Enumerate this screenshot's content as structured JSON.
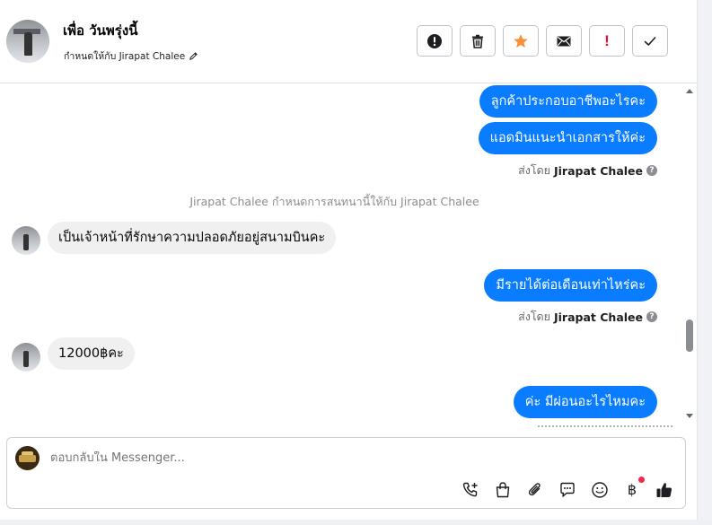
{
  "header": {
    "contact_name": "เพื่อ วันพรุ่งนี้",
    "assigned_label": "กำหนดให้กับ Jirapat Chalee",
    "toolbar": [
      {
        "name": "spam-alert-button",
        "icon": "exclamation-circle-icon"
      },
      {
        "name": "delete-button",
        "icon": "trash-icon"
      },
      {
        "name": "star-button",
        "icon": "star-icon",
        "color": "#f7923b"
      },
      {
        "name": "mark-unread-button",
        "icon": "envelope-icon"
      },
      {
        "name": "follow-up-button",
        "icon": "exclamation-icon",
        "text": "!",
        "color": "#e4162b"
      },
      {
        "name": "mark-done-button",
        "icon": "check-icon"
      }
    ]
  },
  "messages": {
    "out_1": "ลูกค้าประกอบอาชีพอะไรคะ",
    "out_2": "แอดมินแนะนำเอกสารให้ค่ะ",
    "sent_by_1": {
      "prefix": "ส่งโดย",
      "name": "Jirapat Chalee"
    },
    "system_note": "Jirapat Chalee กำหนดการสนทนานี้ให้กับ Jirapat Chalee",
    "in_1": "เป็นเจ้าหน้าที่รักษาความปลอดภัยอยู่สนามบินคะ",
    "out_3": "มีรายได้ต่อเดือนเท่าไหร่คะ",
    "sent_by_2": {
      "prefix": "ส่งโดย",
      "name": "Jirapat Chalee"
    },
    "in_2": "12000฿คะ",
    "out_4": "ค่ะ มีผ่อนอะไรไหมคะ"
  },
  "composer": {
    "placeholder": "ตอบกลับใน Messenger...",
    "tools": [
      "phone-add-icon",
      "shopping-bag-icon",
      "paperclip-icon",
      "saved-replies-icon",
      "emoji-icon",
      "baht-icon",
      "thumbs-up-icon"
    ],
    "baht_symbol": "฿"
  },
  "colors": {
    "outgoing_bubble": "#0a7cff",
    "incoming_bubble": "#f0f0f0",
    "star": "#f7923b",
    "alert_red": "#e4162b"
  }
}
